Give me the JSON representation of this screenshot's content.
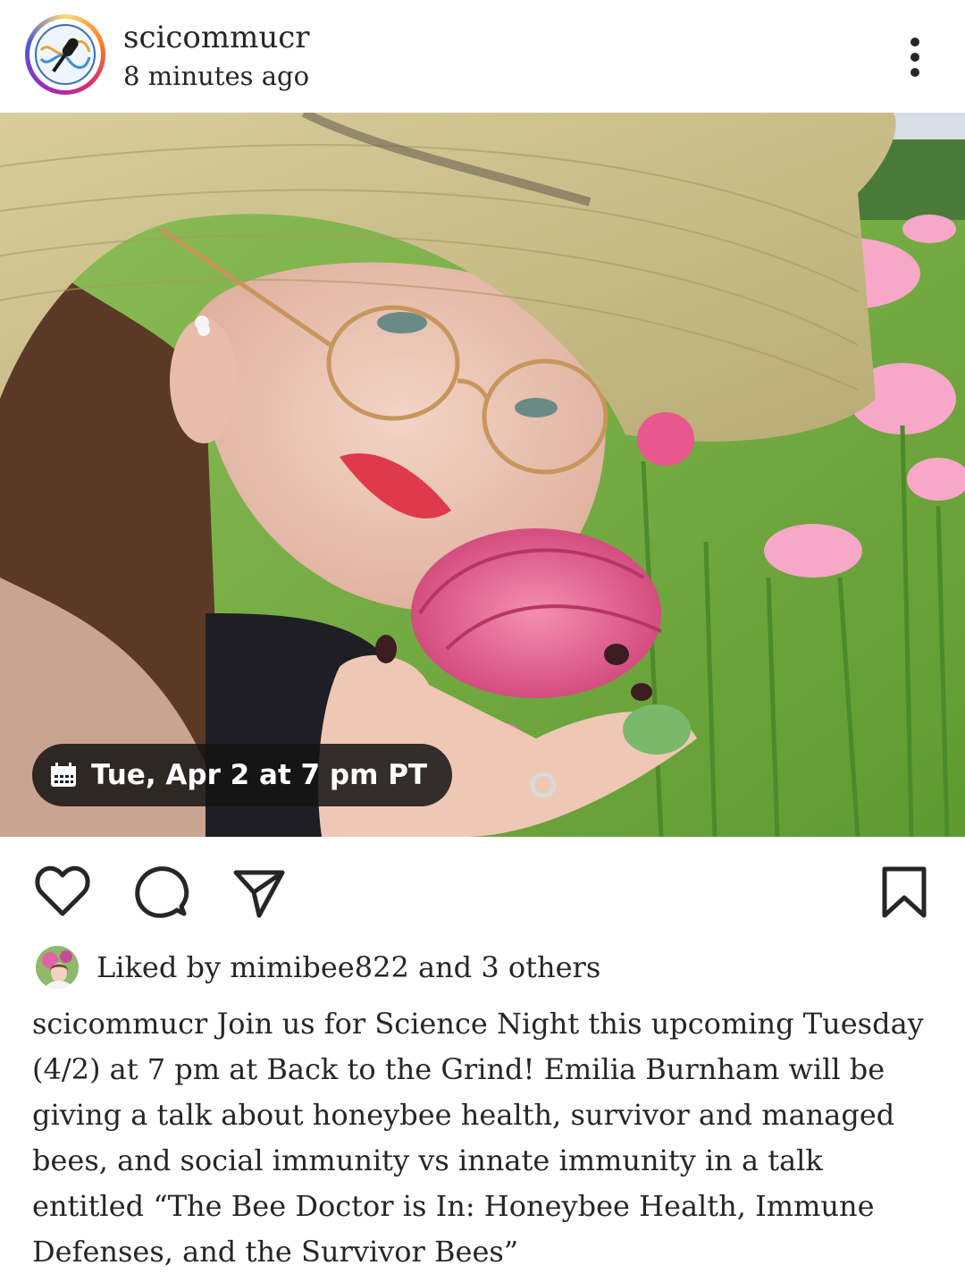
{
  "post": {
    "username": "scicommucr",
    "time_ago": "8 minutes ago",
    "avatar_icon": "microphone-dna-logo",
    "more_icon": "more-vertical-icon"
  },
  "photo": {
    "event_chip": {
      "icon": "calendar-icon",
      "text": "Tue, Apr 2 at 7 pm PT"
    }
  },
  "actions": {
    "like_icon": "heart-icon",
    "comment_icon": "comment-icon",
    "share_icon": "send-icon",
    "save_icon": "bookmark-icon"
  },
  "likes": {
    "text": "Liked by mimibee822 and 3 others"
  },
  "caption": {
    "username": "scicommucr",
    "text": "Join us for Science Night this upcoming Tuesday (4/2) at 7 pm at Back to the Grind! Emilia Burnham will be giving a talk about honeybee health, survivor and managed bees, and social immunity vs innate immunity in a talk entitled “The Bee Doctor is In: Honeybee Health, Immune Defenses, and the Survivor Bees”"
  }
}
